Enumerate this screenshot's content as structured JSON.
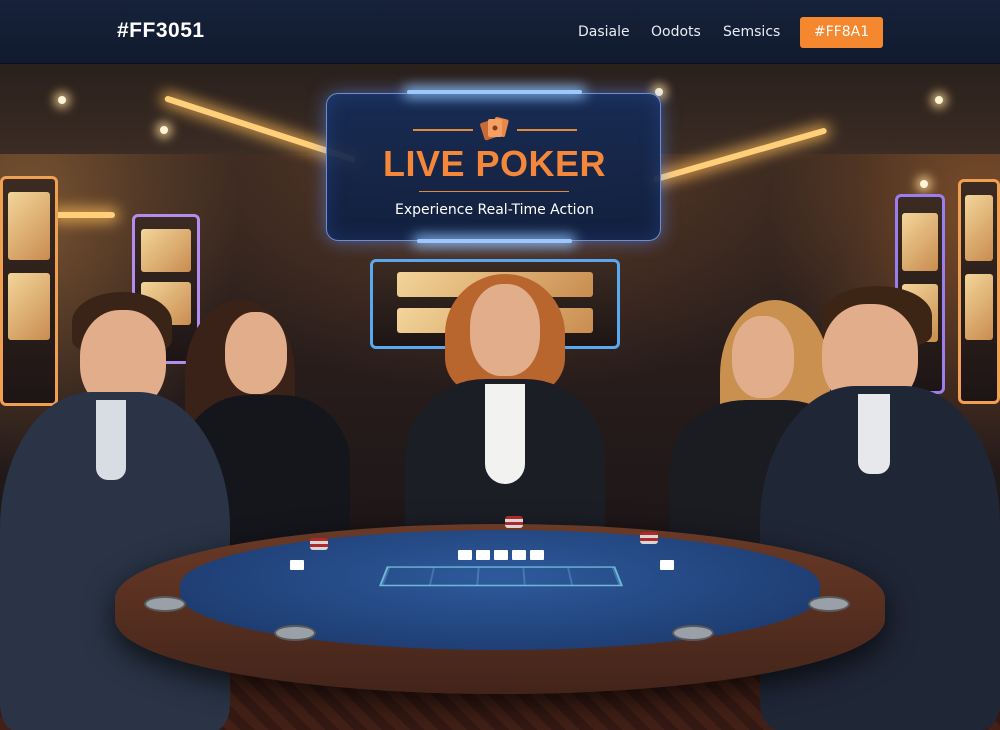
{
  "navbar": {
    "brand": "#FF3051",
    "links": [
      "Dasiale",
      "Oodots",
      "Semsics"
    ],
    "cta_label": "#FF8A1",
    "accent_color": "#f5872f"
  },
  "hero": {
    "title": "LIVE POKER",
    "subtitle": "Experience Real-Time Action",
    "title_color": "#f4873a",
    "icon": "playing-cards-icon"
  }
}
